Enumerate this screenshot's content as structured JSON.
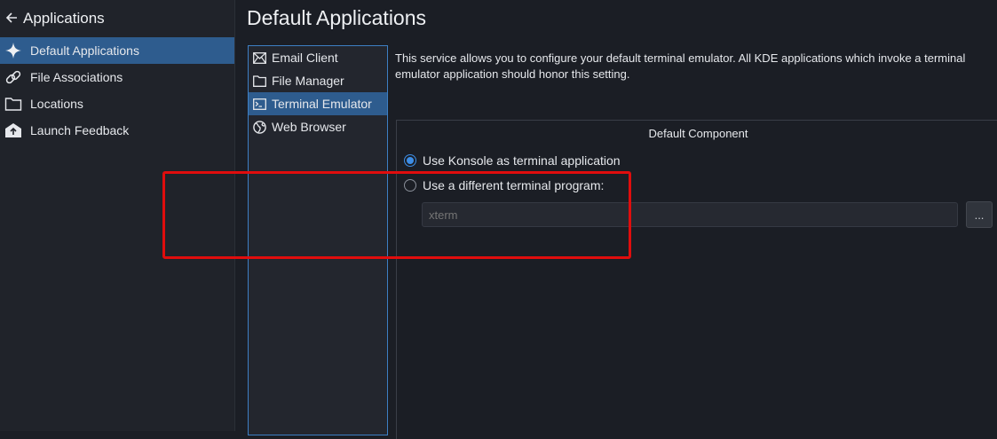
{
  "sidebar": {
    "back_icon": "arrow-left-icon",
    "title": "Applications",
    "items": [
      {
        "label": "Default Applications",
        "icon": "sparkle-icon",
        "active": true
      },
      {
        "label": "File Associations",
        "icon": "link-icon",
        "active": false
      },
      {
        "label": "Locations",
        "icon": "folder-icon",
        "active": false
      },
      {
        "label": "Launch Feedback",
        "icon": "launch-envelope-icon",
        "active": false
      }
    ]
  },
  "main": {
    "title": "Default Applications",
    "categories": [
      {
        "label": "Email Client",
        "icon": "envelope-icon",
        "active": false
      },
      {
        "label": "File Manager",
        "icon": "folder-icon",
        "active": false
      },
      {
        "label": "Terminal Emulator",
        "icon": "terminal-icon",
        "active": true
      },
      {
        "label": "Web Browser",
        "icon": "globe-icon",
        "active": false
      }
    ],
    "description": "This service allows you to configure your default terminal emulator. All KDE applications which invoke a terminal emulator application should honor this setting.",
    "group": {
      "title": "Default Component",
      "option_konsole": "Use Konsole as terminal application",
      "option_konsole_selected": true,
      "option_other": "Use a different terminal program:",
      "option_other_selected": false,
      "program_placeholder": "xterm",
      "browse_label": "..."
    }
  },
  "colors": {
    "accent": "#2e5c8e",
    "highlight": "#e00d0d",
    "radio_checked": "#3d8ee6"
  }
}
